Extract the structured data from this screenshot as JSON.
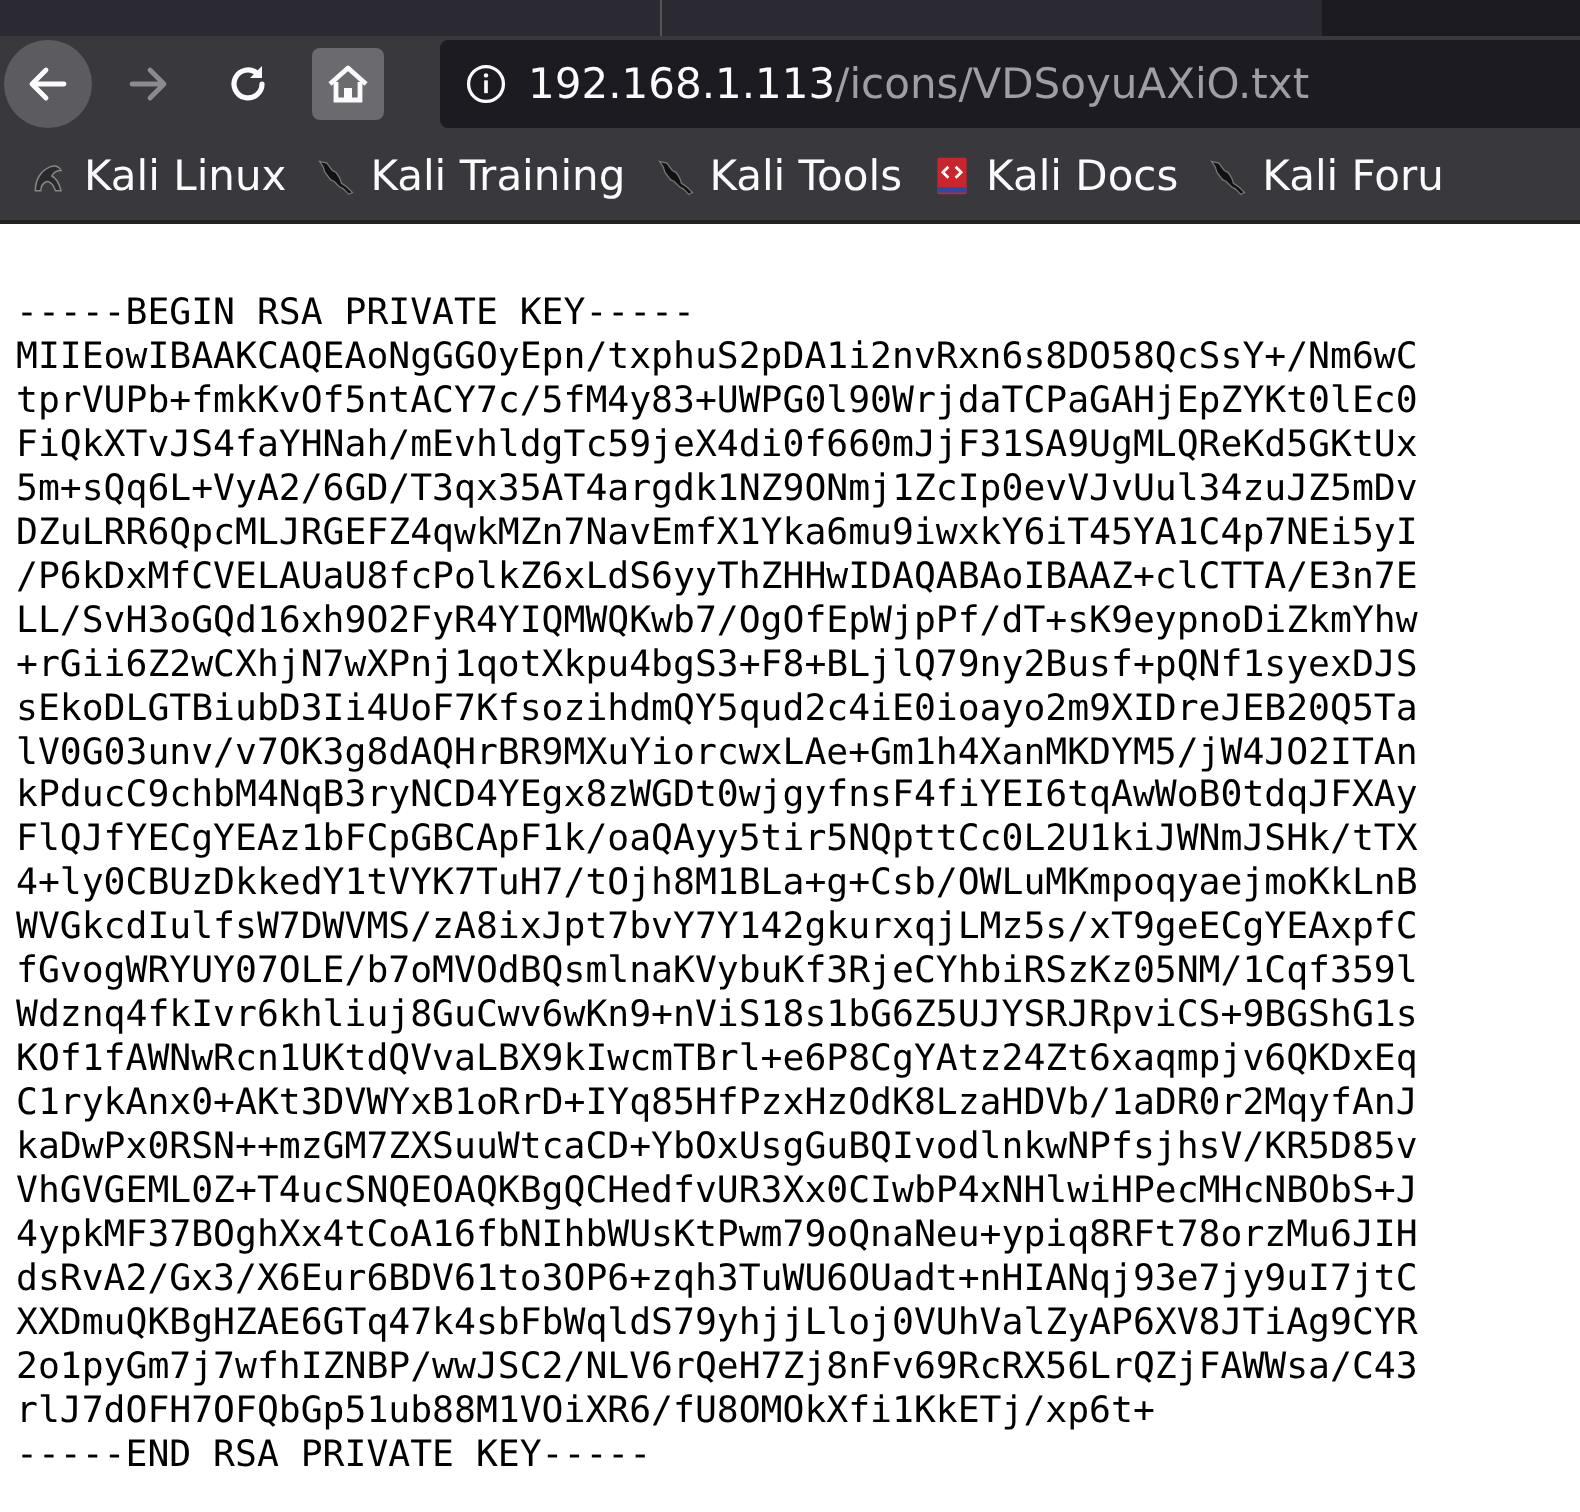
{
  "toolbar": {
    "buttons": [
      {
        "kind": "back",
        "disabled": false,
        "hovered": true
      },
      {
        "kind": "forward",
        "disabled": true,
        "hovered": false
      },
      {
        "kind": "reload",
        "disabled": false,
        "hovered": false
      },
      {
        "kind": "home",
        "disabled": false,
        "hovered": true
      }
    ],
    "address": {
      "host": "192.168.1.113",
      "path": "/icons/VDSoyuAXiO.txt"
    }
  },
  "bookmarks": [
    {
      "label": "Kali Linux",
      "kind": "dragon"
    },
    {
      "label": "Kali Training",
      "kind": "knife"
    },
    {
      "label": "Kali Tools",
      "kind": "knife"
    },
    {
      "label": "Kali Docs",
      "kind": "book"
    },
    {
      "label": "Kali Foru",
      "kind": "knife"
    }
  ],
  "document": {
    "lines": [
      "-----BEGIN RSA PRIVATE KEY-----",
      "MIIEowIBAAKCAQEAoNgGGOyEpn/txphuS2pDA1i2nvRxn6s8DO58QcSsY+/Nm6wC",
      "tprVUPb+fmkKvOf5ntACY7c/5fM4y83+UWPG0l90WrjdaTCPaGAHjEpZYKt0lEc0",
      "FiQkXTvJS4faYHNah/mEvhldgTc59jeX4di0f660mJjF31SA9UgMLQReKd5GKtUx",
      "5m+sQq6L+VyA2/6GD/T3qx35AT4argdk1NZ9ONmj1ZcIp0evVJvUul34zuJZ5mDv",
      "DZuLRR6QpcMLJRGEFZ4qwkMZn7NavEmfX1Yka6mu9iwxkY6iT45YA1C4p7NEi5yI",
      "/P6kDxMfCVELAUaU8fcPolkZ6xLdS6yyThZHHwIDAQABAoIBAAZ+clCTTA/E3n7E",
      "LL/SvH3oGQd16xh9O2FyR4YIQMWQKwb7/OgOfEpWjpPf/dT+sK9eypnoDiZkmYhw",
      "+rGii6Z2wCXhjN7wXPnj1qotXkpu4bgS3+F8+BLjlQ79ny2Busf+pQNf1syexDJS",
      "sEkoDLGTBiubD3Ii4UoF7KfsozihdmQY5qud2c4iE0ioayo2m9XIDreJEB20Q5Ta",
      "lV0G03unv/v7OK3g8dAQHrBR9MXuYiorcwxLAe+Gm1h4XanMKDYM5/jW4JO2ITAn",
      "kPducC9chbM4NqB3ryNCD4YEgx8zWGDt0wjgyfnsF4fiYEI6tqAwWoB0tdqJFXAy",
      "FlQJfYECgYEAz1bFCpGBCApF1k/oaQAyy5tir5NQpttCc0L2U1kiJWNmJSHk/tTX",
      "4+ly0CBUzDkkedY1tVYK7TuH7/tOjh8M1BLa+g+Csb/OWLuMKmpoqyaejmoKkLnB",
      "WVGkcdIulfsW7DWVMS/zA8ixJpt7bvY7Y142gkurxqjLMz5s/xT9geECgYEAxpfC",
      "fGvogWRYUY07OLE/b7oMVOdBQsmlnaKVybuKf3RjeCYhbiRSzKz05NM/1Cqf359l",
      "Wdznq4fkIvr6khliuj8GuCwv6wKn9+nViS18s1bG6Z5UJYSRJRpviCS+9BGShG1s",
      "KOf1fAWNwRcn1UKtdQVvaLBX9kIwcmTBrl+e6P8CgYAtz24Zt6xaqmpjv6QKDxEq",
      "C1rykAnx0+AKt3DVWYxB1oRrD+IYq85HfPzxHzOdK8LzaHDVb/1aDR0r2MqyfAnJ",
      "kaDwPx0RSN++mzGM7ZXSuuWtcaCD+YbOxUsgGuBQIvodlnkwNPfsjhsV/KR5D85v",
      "VhGVGEML0Z+T4ucSNQEOAQKBgQCHedfvUR3Xx0CIwbP4xNHlwiHPecMHcNBObS+J",
      "4ypkMF37BOghXx4tCoA16fbNIhbWUsKtPwm79oQnaNeu+ypiq8RFt78orzMu6JIH",
      "dsRvA2/Gx3/X6Eur6BDV61to3OP6+zqh3TuWU6OUadt+nHIANqj93e7jy9uI7jtC",
      "XXDmuQKBgHZAE6GTq47k4sbFbWqldS79yhjjLloj0VUhValZyAP6XV8JTiAg9CYR",
      "2o1pyGm7j7wfhIZNBP/wwJSC2/NLV6rQeH7Zj8nFv69RcRX56LrQZjFAWWsa/C43",
      "rlJ7dOFH7OFQbGp51ub88M1VOiXR6/fU8OMOkXfi1KkETj/xp6t+",
      "-----END RSA PRIVATE KEY-----"
    ]
  }
}
